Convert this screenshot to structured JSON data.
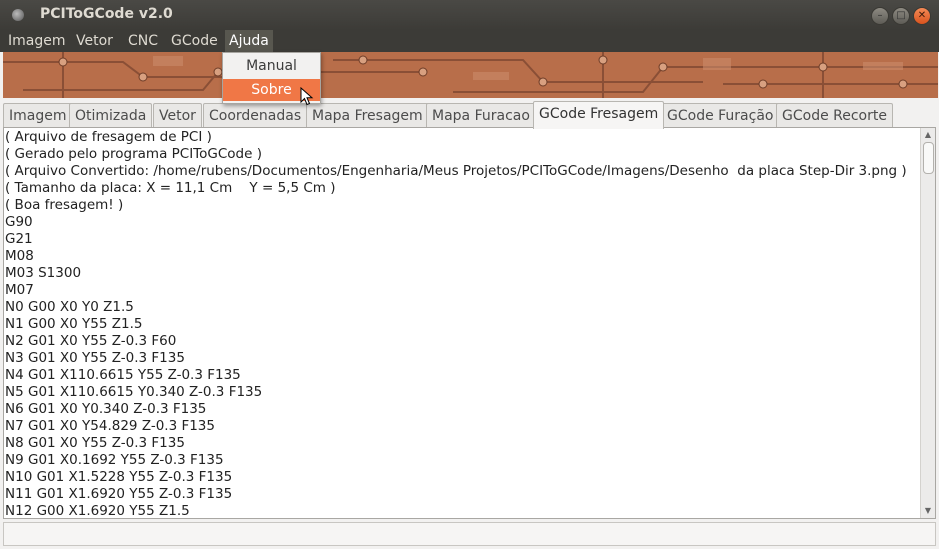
{
  "window": {
    "title": "PCIToGCode  v2.0"
  },
  "menubar": {
    "items": [
      "Imagem",
      "Vetor",
      "CNC",
      "GCode",
      "Ajuda"
    ],
    "active": "Ajuda"
  },
  "help_menu": {
    "items": [
      "Manual",
      "Sobre"
    ],
    "highlighted": "Sobre"
  },
  "tabs": {
    "items": [
      "Imagem",
      "Otimizada",
      "Vetor",
      "Coordenadas",
      "Mapa Fresagem",
      "Mapa Furacao",
      "GCode Fresagem",
      "GCode Furação",
      "GCode Recorte"
    ],
    "active": "GCode Fresagem"
  },
  "gcode_lines": [
    "( Arquivo de fresagem de PCI )",
    "( Gerado pelo programa PCIToGCode )",
    "( Arquivo Convertido: /home/rubens/Documentos/Engenharia/Meus Projetos/PCIToGCode/Imagens/Desenho  da placa Step-Dir 3.png )",
    "( Tamanho da placa: X = 11,1 Cm    Y = 5,5 Cm )",
    "( Boa fresagem! )",
    "G90",
    "G21",
    "M08",
    "M03 S1300",
    "M07",
    "N0 G00 X0 Y0 Z1.5",
    "N1 G00 X0 Y55 Z1.5",
    "N2 G01 X0 Y55 Z-0.3 F60",
    "N3 G01 X0 Y55 Z-0.3 F135",
    "N4 G01 X110.6615 Y55 Z-0.3 F135",
    "N5 G01 X110.6615 Y0.340 Z-0.3 F135",
    "N6 G01 X0 Y0.340 Z-0.3 F135",
    "N7 G01 X0 Y54.829 Z-0.3 F135",
    "N8 G01 X0 Y55 Z-0.3 F135",
    "N9 G01 X0.1692 Y55 Z-0.3 F135",
    "N10 G01 X1.5228 Y55 Z-0.3 F135",
    "N11 G01 X1.6920 Y55 Z-0.3 F135",
    "N12 G00 X1.6920 Y55 Z1.5"
  ],
  "icons": {
    "app": "app-icon",
    "minimize": "minimize-icon",
    "maximize": "maximize-icon",
    "close": "close-icon",
    "scroll_up": "chevron-up-icon",
    "scroll_down": "chevron-down-icon",
    "pointer": "mouse-pointer-icon"
  },
  "colors": {
    "titlebar": "#3c3b37",
    "menu_highlight": "#f07746",
    "banner": "#b86e4a"
  }
}
